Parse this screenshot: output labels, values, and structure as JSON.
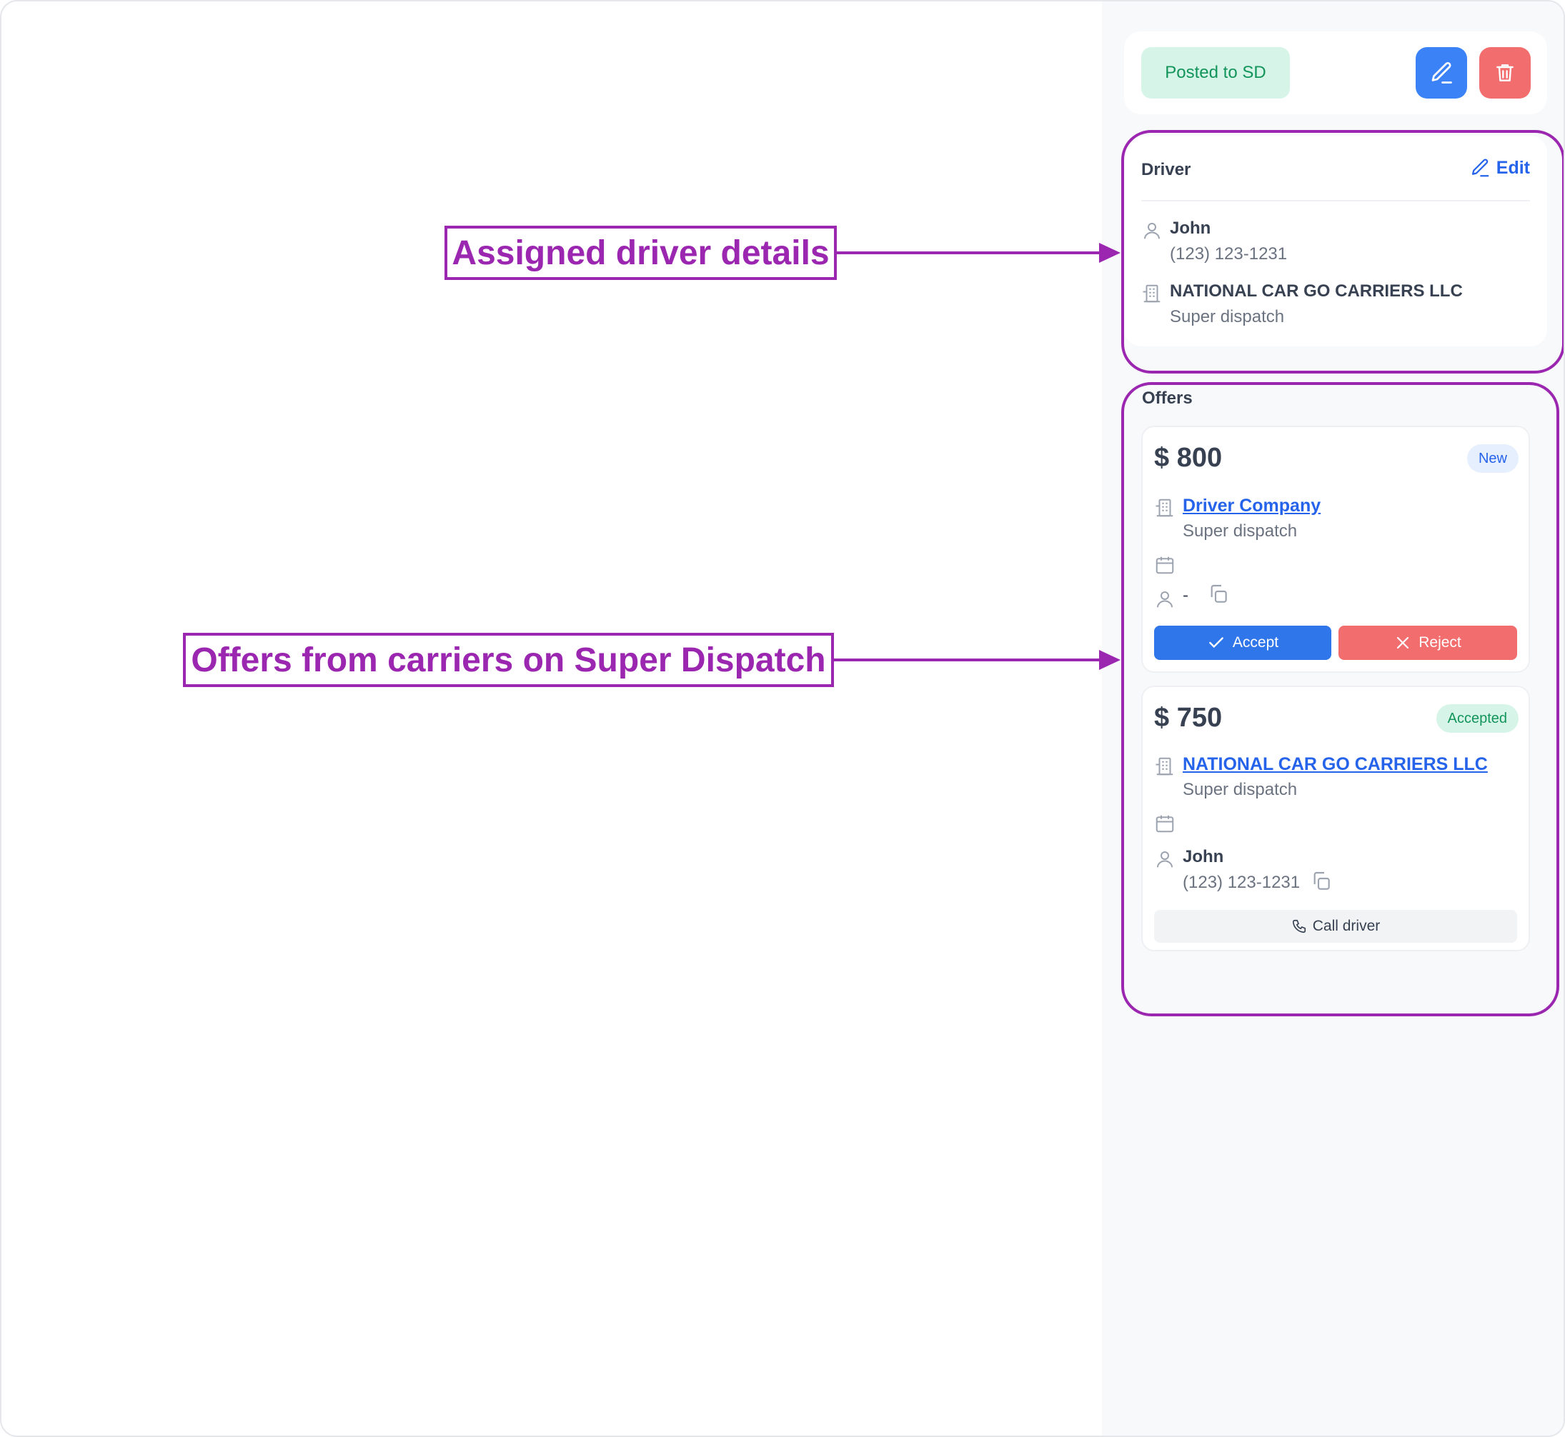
{
  "header": {
    "status": "Posted to SD",
    "edit_icon": "pencil-icon",
    "delete_icon": "trash-icon"
  },
  "driver": {
    "title": "Driver",
    "edit_label": "Edit",
    "name": "John",
    "phone": "(123) 123-1231",
    "company": "NATIONAL CAR GO CARRIERS LLC",
    "source": "Super dispatch"
  },
  "offers": {
    "title": "Offers",
    "items": [
      {
        "price": "$ 800",
        "status": "New",
        "company": "Driver Company",
        "source": "Super dispatch",
        "driver": "-",
        "accept_label": "Accept",
        "reject_label": "Reject"
      },
      {
        "price": "$ 750",
        "status": "Accepted",
        "company": "NATIONAL CAR GO CARRIERS LLC",
        "source": "Super dispatch",
        "driver": "John",
        "phone": "(123) 123-1231",
        "call_label": "Call driver"
      }
    ]
  },
  "annotations": {
    "driver_details": "Assigned driver details",
    "offers": "Offers from carriers on Super Dispatch"
  },
  "colors": {
    "accent": "#3b82f6",
    "danger": "#f26d6d",
    "success": "#12945a",
    "annotation": "#9b27b0"
  }
}
